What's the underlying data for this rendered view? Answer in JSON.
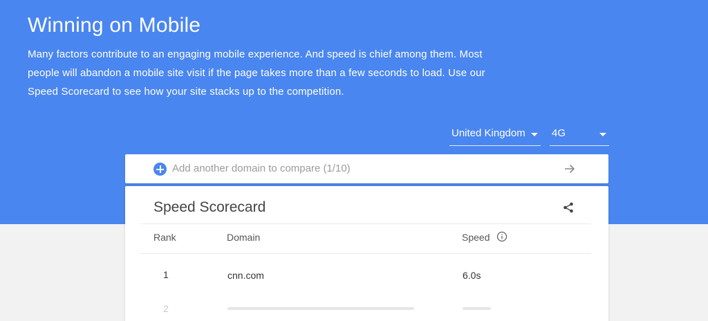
{
  "hero": {
    "title": "Winning on Mobile",
    "description": "Many factors contribute to an engaging mobile experience. And speed is chief among them. Most people will abandon a mobile site visit if the page takes more than a few seconds to load. Use our Speed Scorecard to see how your site stacks up to the competition."
  },
  "filters": {
    "country": "United Kingdom",
    "network": "4G"
  },
  "add_domain": {
    "placeholder": "Add another domain to compare (1/10)"
  },
  "scorecard": {
    "title": "Speed Scorecard",
    "columns": {
      "rank": "Rank",
      "domain": "Domain",
      "speed": "Speed"
    },
    "rows": [
      {
        "rank": "1",
        "domain": "cnn.com",
        "speed": "6.0s"
      },
      {
        "rank": "2",
        "domain": "",
        "speed": ""
      }
    ]
  },
  "colors": {
    "hero_bg": "#4a86ef",
    "page_bg": "#f2f2f2",
    "accent": "#4a86ef"
  },
  "icons": [
    "add-icon",
    "arrow-right-icon",
    "share-icon",
    "info-icon",
    "chevron-down-icon"
  ]
}
